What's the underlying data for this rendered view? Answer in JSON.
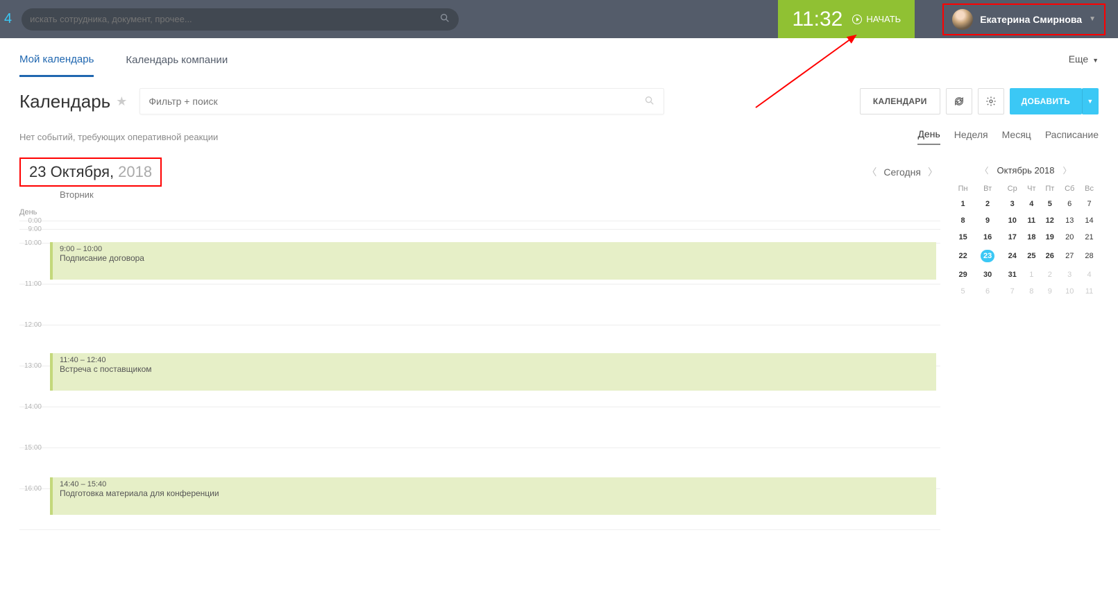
{
  "topbar": {
    "logo_num": "4",
    "search_placeholder": "искать сотрудника, документ, прочее...",
    "clock_time": "11:32",
    "clock_start": "НАЧАТЬ",
    "user_name": "Екатерина Смирнова"
  },
  "tabs": {
    "my_calendar": "Мой календарь",
    "company_calendar": "Календарь компании",
    "more": "Еще"
  },
  "toolbar": {
    "page_title": "Календарь",
    "filter_placeholder": "Фильтр + поиск",
    "calendars_btn": "КАЛЕНДАРИ",
    "add_btn": "ДОБАВИТЬ"
  },
  "status_row": {
    "status_text": "Нет событий, требующих оперативной реакции",
    "views": {
      "day": "День",
      "week": "Неделя",
      "month": "Месяц",
      "schedule": "Расписание"
    }
  },
  "date_header": {
    "date_main": "23 Октября,",
    "date_year": "2018",
    "dow": "Вторник",
    "day_label": "День",
    "today": "Сегодня"
  },
  "timeline": {
    "first_times": [
      "0:00",
      "9:00"
    ],
    "hours": [
      "10:00",
      "11:00",
      "12:00",
      "13:00",
      "14:00",
      "15:00",
      "16:00"
    ],
    "events": [
      {
        "time": "9:00 – 10:00",
        "title": "Подписание договора"
      },
      {
        "time": "11:40 – 12:40",
        "title": "Встреча с поставщиком"
      },
      {
        "time": "14:40 – 15:40",
        "title": "Подготовка материала для конференции"
      }
    ]
  },
  "mini_calendar": {
    "title": "Октябрь 2018",
    "dow": [
      "Пн",
      "Вт",
      "Ср",
      "Чт",
      "Пт",
      "Сб",
      "Вс"
    ],
    "weeks": [
      [
        {
          "d": "1",
          "b": 1
        },
        {
          "d": "2",
          "b": 1
        },
        {
          "d": "3",
          "b": 1
        },
        {
          "d": "4",
          "b": 1
        },
        {
          "d": "5",
          "b": 1
        },
        {
          "d": "6"
        },
        {
          "d": "7"
        }
      ],
      [
        {
          "d": "8",
          "b": 1
        },
        {
          "d": "9",
          "b": 1
        },
        {
          "d": "10",
          "b": 1
        },
        {
          "d": "11",
          "b": 1
        },
        {
          "d": "12",
          "b": 1
        },
        {
          "d": "13"
        },
        {
          "d": "14"
        }
      ],
      [
        {
          "d": "15",
          "b": 1
        },
        {
          "d": "16",
          "b": 1
        },
        {
          "d": "17",
          "b": 1
        },
        {
          "d": "18",
          "b": 1
        },
        {
          "d": "19",
          "b": 1
        },
        {
          "d": "20"
        },
        {
          "d": "21"
        }
      ],
      [
        {
          "d": "22",
          "b": 1
        },
        {
          "d": "23",
          "b": 1,
          "t": 1
        },
        {
          "d": "24",
          "b": 1
        },
        {
          "d": "25",
          "b": 1
        },
        {
          "d": "26",
          "b": 1
        },
        {
          "d": "27"
        },
        {
          "d": "28"
        }
      ],
      [
        {
          "d": "29",
          "b": 1
        },
        {
          "d": "30",
          "b": 1
        },
        {
          "d": "31",
          "b": 1
        },
        {
          "d": "1",
          "m": 1
        },
        {
          "d": "2",
          "m": 1
        },
        {
          "d": "3",
          "m": 1
        },
        {
          "d": "4",
          "m": 1
        }
      ],
      [
        {
          "d": "5",
          "m": 1
        },
        {
          "d": "6",
          "m": 1
        },
        {
          "d": "7",
          "m": 1
        },
        {
          "d": "8",
          "m": 1
        },
        {
          "d": "9",
          "m": 1
        },
        {
          "d": "10",
          "m": 1
        },
        {
          "d": "11",
          "m": 1
        }
      ]
    ]
  }
}
